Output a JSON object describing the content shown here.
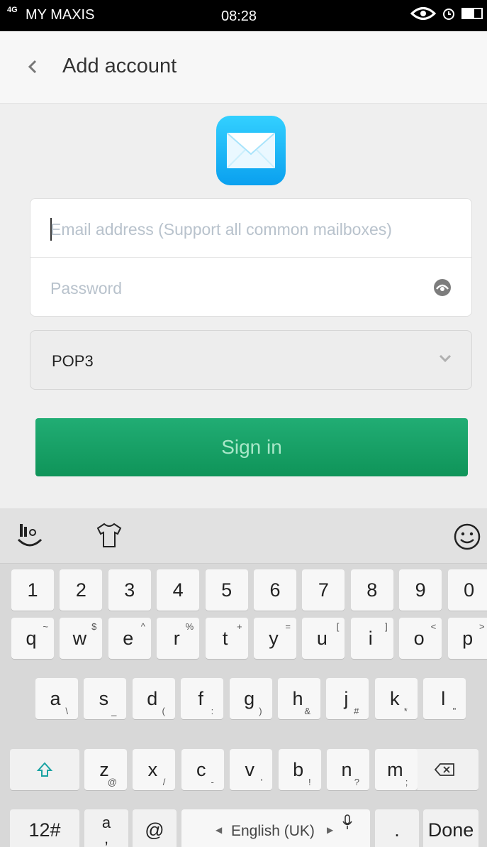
{
  "status_bar": {
    "signal": "4G",
    "carrier": "MY MAXIS",
    "time": "08:28"
  },
  "header": {
    "title": "Add account"
  },
  "form": {
    "email_placeholder": "Email address (Support all common mailboxes)",
    "password_placeholder": "Password",
    "protocol_value": "POP3",
    "sign_in_label": "Sign in"
  },
  "keyboard": {
    "row_numbers": [
      "1",
      "2",
      "3",
      "4",
      "5",
      "6",
      "7",
      "8",
      "9",
      "0"
    ],
    "row_q": [
      {
        "k": "q",
        "a": "~"
      },
      {
        "k": "w",
        "a": "$"
      },
      {
        "k": "e",
        "a": "^"
      },
      {
        "k": "r",
        "a": "%"
      },
      {
        "k": "t",
        "a": "+"
      },
      {
        "k": "y",
        "a": "="
      },
      {
        "k": "u",
        "a": "["
      },
      {
        "k": "i",
        "a": "]"
      },
      {
        "k": "o",
        "a": "<"
      },
      {
        "k": "p",
        "a": ">"
      }
    ],
    "row_a": [
      {
        "k": "a",
        "a": "\\"
      },
      {
        "k": "s",
        "a": "_"
      },
      {
        "k": "d",
        "a": "("
      },
      {
        "k": "f",
        "a": ":"
      },
      {
        "k": "g",
        "a": ")"
      },
      {
        "k": "h",
        "a": "&"
      },
      {
        "k": "j",
        "a": "#"
      },
      {
        "k": "k",
        "a": "*"
      },
      {
        "k": "l",
        "a": "\""
      }
    ],
    "row_z": [
      {
        "k": "z",
        "a": "@"
      },
      {
        "k": "x",
        "a": "/"
      },
      {
        "k": "c",
        "a": "-"
      },
      {
        "k": "v",
        "a": "'"
      },
      {
        "k": "b",
        "a": "!"
      },
      {
        "k": "n",
        "a": "?"
      },
      {
        "k": "m",
        "a": ";"
      }
    ],
    "mode_key": "12#",
    "punct_key": {
      "top": "a",
      "bottom": ","
    },
    "at_key": "@",
    "space_label": "English (UK)",
    "period_key": ".",
    "done_key": "Done"
  }
}
